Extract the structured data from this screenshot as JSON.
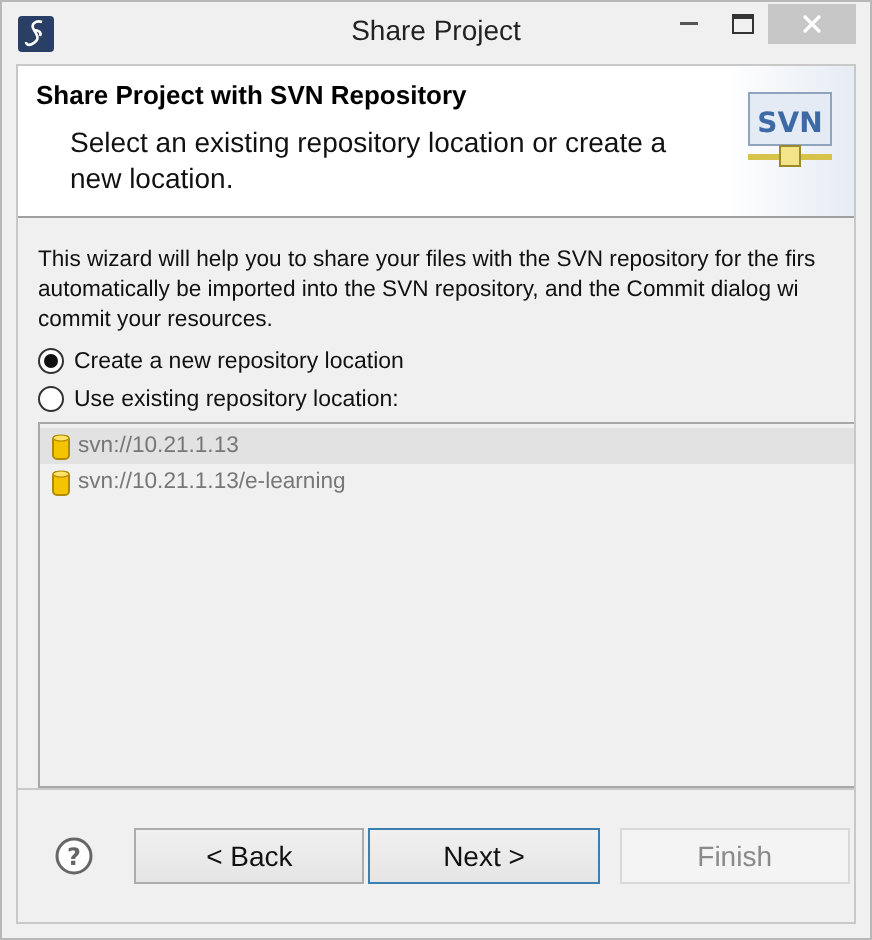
{
  "window": {
    "title": "Share Project"
  },
  "header": {
    "logo": "SVN",
    "title": "Share Project with SVN Repository",
    "description": "Select an existing repository location or create a new location."
  },
  "intro": "This wizard will help you to share your files with the SVN repository for the firs\nautomatically be imported into the SVN repository, and the Commit dialog wi\ncommit your resources.",
  "options": [
    {
      "label": "Create a new repository location",
      "selected": true
    },
    {
      "label": "Use existing repository location:",
      "selected": false
    }
  ],
  "repositories": {
    "disabled": true,
    "items": [
      {
        "label": "svn://10.21.1.13",
        "selected": true
      },
      {
        "label": "svn://10.21.1.13/e-learning",
        "selected": false
      }
    ]
  },
  "help": {
    "label": "?"
  },
  "buttons": [
    {
      "label": "< Back",
      "default": false,
      "disabled": false
    },
    {
      "label": "Next >",
      "default": true,
      "disabled": false
    },
    {
      "label": "Finish",
      "default": false,
      "disabled": true
    }
  ]
}
